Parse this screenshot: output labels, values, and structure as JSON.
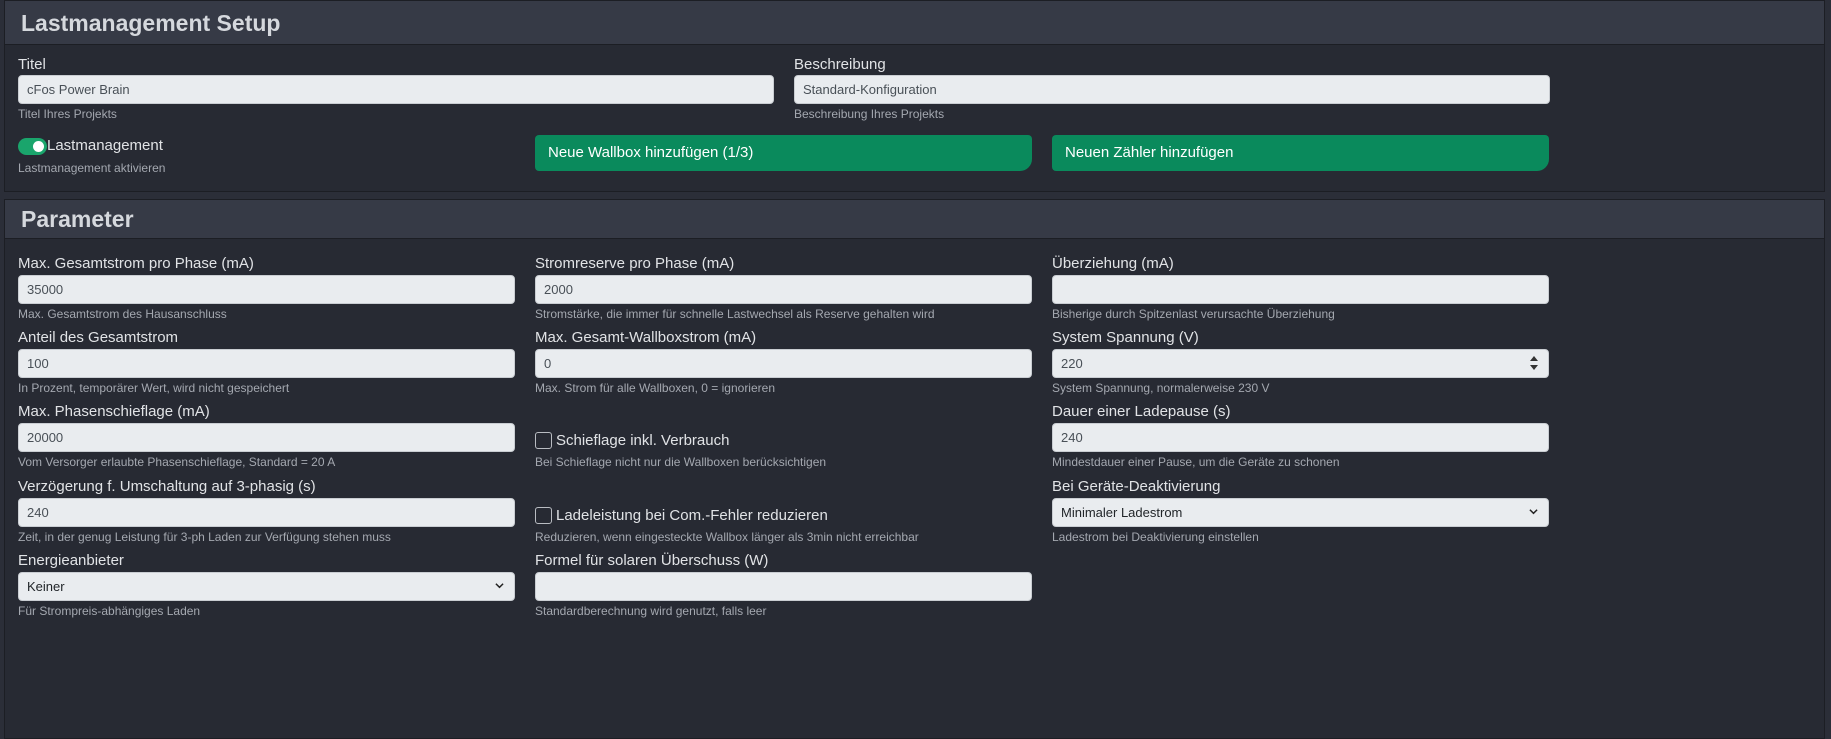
{
  "setup": {
    "header": "Lastmanagement Setup",
    "title_label": "Titel",
    "title_value": "cFos Power Brain",
    "title_help": "Titel Ihres Projekts",
    "desc_label": "Beschreibung",
    "desc_value": "Standard-Konfiguration",
    "desc_help": "Beschreibung Ihres Projekts",
    "lm_toggle_label": "Lastmanagement",
    "lm_toggle_on": true,
    "lm_help": "Lastmanagement aktivieren",
    "add_wallbox_label": "Neue Wallbox hinzufügen (1/3)",
    "add_meter_label": "Neuen Zähler hinzufügen",
    "accent_color": "#0a8a5c"
  },
  "params": {
    "header": "Parameter",
    "max_total": {
      "label": "Max. Gesamtstrom pro Phase (mA)",
      "value": "35000",
      "help": "Max. Gesamtstrom des Hausanschluss"
    },
    "reserve": {
      "label": "Stromreserve pro Phase (mA)",
      "value": "2000",
      "help": "Stromstärke, die immer für schnelle Lastwechsel als Reserve gehalten wird"
    },
    "overdraw": {
      "label": "Überziehung (mA)",
      "value": "",
      "help": "Bisherige durch Spitzenlast verursachte Überziehung"
    },
    "share": {
      "label": "Anteil des Gesamtstrom",
      "value": "100",
      "help": "In Prozent, temporärer Wert, wird nicht gespeichert"
    },
    "max_wallbox": {
      "label": "Max. Gesamt-Wallboxstrom (mA)",
      "value": "0",
      "help": "Max. Strom für alle Wallboxen, 0 = ignorieren"
    },
    "voltage": {
      "label": "System Spannung (V)",
      "value": "220",
      "help": "System Spannung, normalerweise 230 V"
    },
    "imbalance": {
      "label": "Max. Phasenschieflage (mA)",
      "value": "20000",
      "help": "Vom Versorger erlaubte Phasenschieflage, Standard = 20 A"
    },
    "imbalance_cons": {
      "label": "Schieflage inkl. Verbrauch",
      "checked": false,
      "help": "Bei Schieflage nicht nur die Wallboxen berücksichtigen"
    },
    "pause": {
      "label": "Dauer einer Ladepause (s)",
      "value": "240",
      "help": "Mindestdauer einer Pause, um die Geräte zu schonen"
    },
    "delay3": {
      "label": "Verzögerung f. Umschaltung auf 3-phasig (s)",
      "value": "240",
      "help": "Zeit, in der genug Leistung für 3-ph Laden zur Verfügung stehen muss"
    },
    "reduce": {
      "label": "Ladeleistung bei Com.-Fehler reduzieren",
      "checked": false,
      "help": "Reduzieren, wenn eingesteckte Wallbox länger als 3min nicht erreichbar"
    },
    "deact": {
      "label": "Bei Geräte-Deaktivierung",
      "value": "Minimaler Ladestrom",
      "help": "Ladestrom bei Deaktivierung einstellen"
    },
    "provider": {
      "label": "Energieanbieter",
      "value": "Keiner",
      "help": "Für Strompreis-abhängiges Laden"
    },
    "solar": {
      "label": "Formel für solaren Überschuss (W)",
      "value": "",
      "help": "Standardberechnung wird genutzt, falls leer"
    }
  },
  "icons": {
    "select": "chevron-down-icon",
    "number": "spinner-icon",
    "toggle": "toggle-switch-icon",
    "checkbox": "checkbox-icon"
  }
}
